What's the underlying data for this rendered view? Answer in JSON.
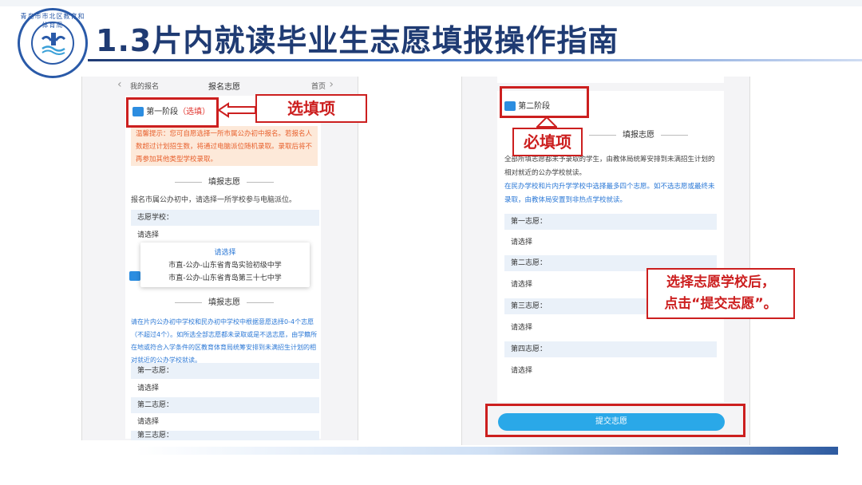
{
  "slide": {
    "title": "1.3片内就读毕业生志愿填报操作指南",
    "logo_text": "青岛市市北区教育和体育局"
  },
  "left_screen": {
    "nav": {
      "back": "我的报名",
      "title": "报名志愿",
      "home": "首页"
    },
    "stage1": {
      "label": "第一阶段",
      "tag": "（选填）"
    },
    "warning": "温馨提示：您可自愿选择一所市属公办初中报名。若报名人数超过计划招生数，将通过电脑派位随机录取。录取后将不再参加其他类型学校录取。",
    "section_title": "填报志愿",
    "instruction": "报名市属公办初中，请选择一所学校参与电脑派位。",
    "school_label": "志愿学校：",
    "placeholder": "请选择",
    "popup": {
      "placeholder": "请选择",
      "options": [
        "市直-公办-山东省青岛实验初级中学",
        "市直-公办-山东省青岛第三十七中学"
      ]
    },
    "section_title2": "填报志愿",
    "instruction2": "请在片内公办初中学校和民办初中学校中根据意愿选择0-4个志愿（不超过4个）。如所选全部志愿都未录取或是不选志愿，由学籍所在地或符合入学条件的区教育体育局统筹安排到未满招生计划的相对就近的公办学校就读。",
    "choices": [
      {
        "label": "第一志愿：",
        "value": "请选择"
      },
      {
        "label": "第二志愿：",
        "value": "请选择"
      },
      {
        "label": "第三志愿：",
        "value": ""
      }
    ]
  },
  "right_screen": {
    "stage2": {
      "label": "第二阶段"
    },
    "section_title": "填报志愿",
    "instruction_black": "全部所填志愿都未予录取的学生，由教体局统筹安排到未满招生计划的相对就近的公办学校就读。",
    "instruction_blue": "在民办学校和片内升学学校中选择最多四个志愿。如不选志愿或最终未录取，由教体局安置到非热点学校就读。",
    "choices": [
      {
        "label": "第一志愿：",
        "value": "请选择"
      },
      {
        "label": "第二志愿：",
        "value": "请选择"
      },
      {
        "label": "第三志愿：",
        "value": "请选择"
      },
      {
        "label": "第四志愿：",
        "value": "请选择"
      }
    ],
    "submit": "提交志愿"
  },
  "callouts": {
    "optional": "选填项",
    "required": "必填项",
    "note": "选择志愿学校后，\n点击“提交志愿”。"
  },
  "colors": {
    "title": "#1f3b73",
    "callout_red": "#cc1f1f",
    "link_blue": "#2b78d6",
    "submit_blue": "#2aa8e8"
  }
}
